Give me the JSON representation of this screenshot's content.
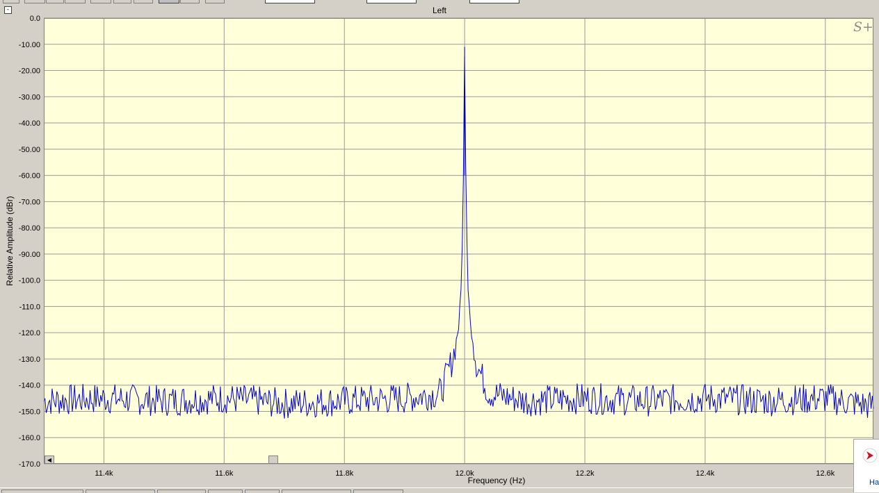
{
  "window": {
    "title": "Left",
    "collapse_label": "-"
  },
  "logo": {
    "text": "S+"
  },
  "side_panel": {
    "text": "Ha"
  },
  "chart_data": {
    "type": "line",
    "title": "Left",
    "xlabel": "Frequency (Hz)",
    "ylabel": "Relative Amplitude (dBr)",
    "xlim": [
      11300,
      12680
    ],
    "ylim": [
      -170,
      0
    ],
    "grid": true,
    "y_ticks": [
      {
        "value": 0,
        "label": "0.0"
      },
      {
        "value": -10,
        "label": "-10.00"
      },
      {
        "value": -20,
        "label": "-20.00"
      },
      {
        "value": -30,
        "label": "-30.00"
      },
      {
        "value": -40,
        "label": "-40.00"
      },
      {
        "value": -50,
        "label": "-50.00"
      },
      {
        "value": -60,
        "label": "-60.00"
      },
      {
        "value": -70,
        "label": "-70.00"
      },
      {
        "value": -80,
        "label": "-80.00"
      },
      {
        "value": -90,
        "label": "-90.00"
      },
      {
        "value": -100,
        "label": "-100.0"
      },
      {
        "value": -110,
        "label": "-110.0"
      },
      {
        "value": -120,
        "label": "-120.0"
      },
      {
        "value": -130,
        "label": "-130.0"
      },
      {
        "value": -140,
        "label": "-140.0"
      },
      {
        "value": -150,
        "label": "-150.0"
      },
      {
        "value": -160,
        "label": "-160.0"
      },
      {
        "value": -170,
        "label": "-170.0"
      }
    ],
    "x_ticks": [
      {
        "value": 11400,
        "label": "11.4k"
      },
      {
        "value": 11600,
        "label": "11.6k"
      },
      {
        "value": 11800,
        "label": "11.8k"
      },
      {
        "value": 12000,
        "label": "12.0k"
      },
      {
        "value": 12200,
        "label": "12.2k"
      },
      {
        "value": 12400,
        "label": "12.4k"
      },
      {
        "value": 12600,
        "label": "12.6k"
      }
    ],
    "series": [
      {
        "color": "#0000cc",
        "peak_frequency": 12000,
        "peak_level": -11,
        "noise_floor": -146,
        "x": [
          11300,
          11400,
          11500,
          11600,
          11700,
          11800,
          11900,
          11960,
          11980,
          11990,
          11995,
          11998,
          12000,
          12002,
          12005,
          12010,
          12020,
          12040,
          12100,
          12200,
          12300,
          12400,
          12500,
          12600,
          12680
        ],
        "y": [
          -146,
          -145,
          -146,
          -145,
          -147,
          -146,
          -145,
          -143,
          -130,
          -118,
          -100,
          -60,
          -11,
          -60,
          -100,
          -118,
          -132,
          -143,
          -146,
          -145,
          -146,
          -145,
          -146,
          -145,
          -148
        ]
      }
    ]
  }
}
